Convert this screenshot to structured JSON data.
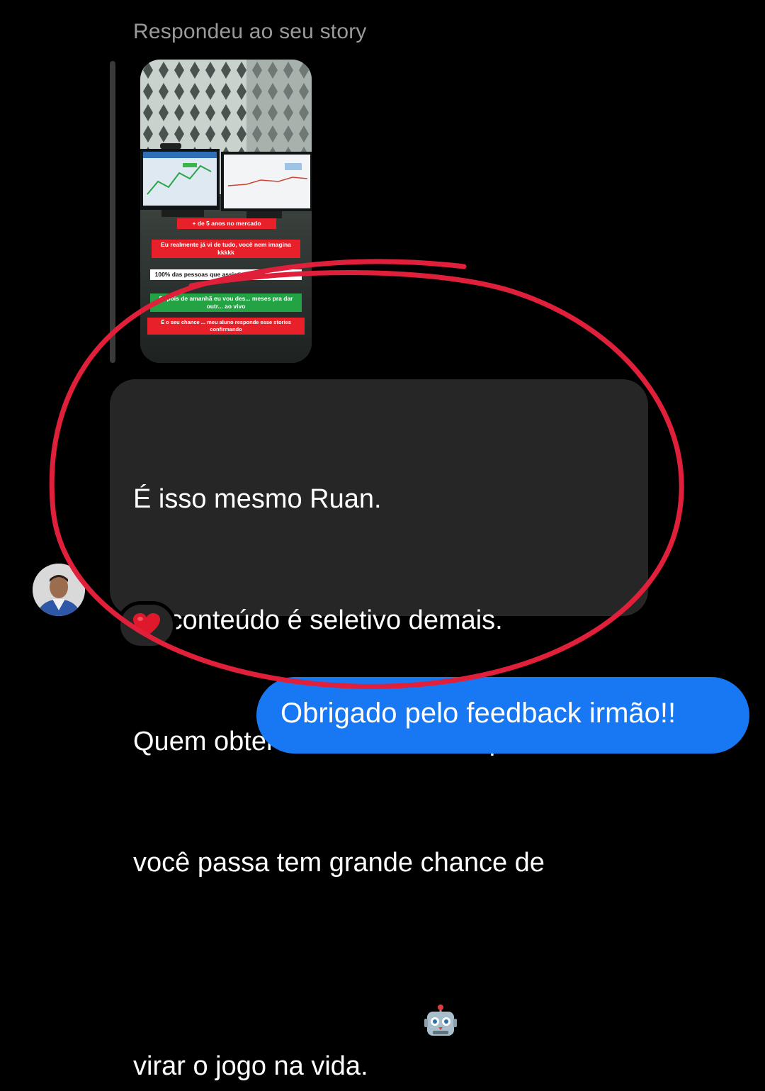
{
  "reply_context": {
    "label": "Respondeu ao seu story"
  },
  "story": {
    "overlay_1": "+ de 5 anos no mercado",
    "overlay_2": "Eu realmente já vi de tudo, você nem imagina kkkkk",
    "overlay_3": "100% das pessoas que assisti... hoje s... mentoria",
    "overlay_4": "Depois de amanhã eu vou des... meses pra dar outr... ao vivo",
    "overlay_5": "É o seu chance ... meu aluno responde esse stories confirmando"
  },
  "message": {
    "lines": [
      "É isso mesmo Ruan.",
      " O conteúdo é seletivo demais.",
      "Quem obter o conhecimento que",
      "você passa tem grande chance de",
      "virar o jogo na vida."
    ],
    "emoji": "robot-face-emoji",
    "reaction": "red-heart-emoji"
  },
  "sent": {
    "text": "Obrigado pelo feedback irmão!!"
  },
  "colors": {
    "background": "#000000",
    "received_bubble": "#262626",
    "sent_bubble": "#1877f2",
    "annotation_ring": "#e0203a",
    "muted_text": "#9a9a9a"
  }
}
